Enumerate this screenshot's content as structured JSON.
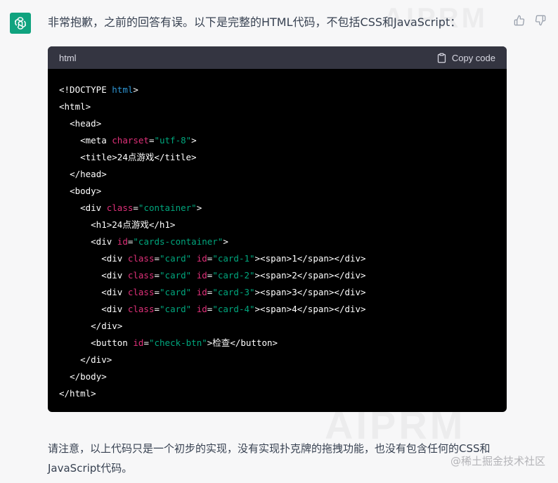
{
  "message": {
    "intro": "非常抱歉，之前的回答有误。以下是完整的HTML代码，不包括CSS和JavaScript：",
    "outro": "请注意，以上代码只是一个初步的实现，没有实现扑克牌的拖拽功能，也没有包含任何的CSS和JavaScript代码。"
  },
  "code_block": {
    "language": "html",
    "copy_label": "Copy code",
    "lines": [
      [
        {
          "t": "tag",
          "v": "<!DOCTYPE "
        },
        {
          "t": "kw",
          "v": "html"
        },
        {
          "t": "tag",
          "v": ">"
        }
      ],
      [
        {
          "t": "tag",
          "v": "<html>"
        }
      ],
      [
        {
          "t": "text",
          "v": "  "
        },
        {
          "t": "tag",
          "v": "<head>"
        }
      ],
      [
        {
          "t": "text",
          "v": "    "
        },
        {
          "t": "tag",
          "v": "<meta "
        },
        {
          "t": "attrname",
          "v": "charset"
        },
        {
          "t": "tag",
          "v": "="
        },
        {
          "t": "str",
          "v": "\"utf-8\""
        },
        {
          "t": "tag",
          "v": ">"
        }
      ],
      [
        {
          "t": "text",
          "v": "    "
        },
        {
          "t": "tag",
          "v": "<title>"
        },
        {
          "t": "text",
          "v": "24点游戏"
        },
        {
          "t": "tag",
          "v": "</title>"
        }
      ],
      [
        {
          "t": "text",
          "v": "  "
        },
        {
          "t": "tag",
          "v": "</head>"
        }
      ],
      [
        {
          "t": "text",
          "v": "  "
        },
        {
          "t": "tag",
          "v": "<body>"
        }
      ],
      [
        {
          "t": "text",
          "v": "    "
        },
        {
          "t": "tag",
          "v": "<div "
        },
        {
          "t": "attrname",
          "v": "class"
        },
        {
          "t": "tag",
          "v": "="
        },
        {
          "t": "str",
          "v": "\"container\""
        },
        {
          "t": "tag",
          "v": ">"
        }
      ],
      [
        {
          "t": "text",
          "v": "      "
        },
        {
          "t": "tag",
          "v": "<h1>"
        },
        {
          "t": "text",
          "v": "24点游戏"
        },
        {
          "t": "tag",
          "v": "</h1>"
        }
      ],
      [
        {
          "t": "text",
          "v": "      "
        },
        {
          "t": "tag",
          "v": "<div "
        },
        {
          "t": "attrname",
          "v": "id"
        },
        {
          "t": "tag",
          "v": "="
        },
        {
          "t": "str",
          "v": "\"cards-container\""
        },
        {
          "t": "tag",
          "v": ">"
        }
      ],
      [
        {
          "t": "text",
          "v": "        "
        },
        {
          "t": "tag",
          "v": "<div "
        },
        {
          "t": "attrname",
          "v": "class"
        },
        {
          "t": "tag",
          "v": "="
        },
        {
          "t": "str",
          "v": "\"card\""
        },
        {
          "t": "text",
          "v": " "
        },
        {
          "t": "attrname",
          "v": "id"
        },
        {
          "t": "tag",
          "v": "="
        },
        {
          "t": "str",
          "v": "\"card-1\""
        },
        {
          "t": "tag",
          "v": "><span>"
        },
        {
          "t": "text",
          "v": "1"
        },
        {
          "t": "tag",
          "v": "</span></div>"
        }
      ],
      [
        {
          "t": "text",
          "v": "        "
        },
        {
          "t": "tag",
          "v": "<div "
        },
        {
          "t": "attrname",
          "v": "class"
        },
        {
          "t": "tag",
          "v": "="
        },
        {
          "t": "str",
          "v": "\"card\""
        },
        {
          "t": "text",
          "v": " "
        },
        {
          "t": "attrname",
          "v": "id"
        },
        {
          "t": "tag",
          "v": "="
        },
        {
          "t": "str",
          "v": "\"card-2\""
        },
        {
          "t": "tag",
          "v": "><span>"
        },
        {
          "t": "text",
          "v": "2"
        },
        {
          "t": "tag",
          "v": "</span></div>"
        }
      ],
      [
        {
          "t": "text",
          "v": "        "
        },
        {
          "t": "tag",
          "v": "<div "
        },
        {
          "t": "attrname",
          "v": "class"
        },
        {
          "t": "tag",
          "v": "="
        },
        {
          "t": "str",
          "v": "\"card\""
        },
        {
          "t": "text",
          "v": " "
        },
        {
          "t": "attrname",
          "v": "id"
        },
        {
          "t": "tag",
          "v": "="
        },
        {
          "t": "str",
          "v": "\"card-3\""
        },
        {
          "t": "tag",
          "v": "><span>"
        },
        {
          "t": "text",
          "v": "3"
        },
        {
          "t": "tag",
          "v": "</span></div>"
        }
      ],
      [
        {
          "t": "text",
          "v": "        "
        },
        {
          "t": "tag",
          "v": "<div "
        },
        {
          "t": "attrname",
          "v": "class"
        },
        {
          "t": "tag",
          "v": "="
        },
        {
          "t": "str",
          "v": "\"card\""
        },
        {
          "t": "text",
          "v": " "
        },
        {
          "t": "attrname",
          "v": "id"
        },
        {
          "t": "tag",
          "v": "="
        },
        {
          "t": "str",
          "v": "\"card-4\""
        },
        {
          "t": "tag",
          "v": "><span>"
        },
        {
          "t": "text",
          "v": "4"
        },
        {
          "t": "tag",
          "v": "</span></div>"
        }
      ],
      [
        {
          "t": "text",
          "v": "      "
        },
        {
          "t": "tag",
          "v": "</div>"
        }
      ],
      [
        {
          "t": "text",
          "v": "      "
        },
        {
          "t": "tag",
          "v": "<button "
        },
        {
          "t": "attrname",
          "v": "id"
        },
        {
          "t": "tag",
          "v": "="
        },
        {
          "t": "str",
          "v": "\"check-btn\""
        },
        {
          "t": "tag",
          "v": ">"
        },
        {
          "t": "text",
          "v": "检查"
        },
        {
          "t": "tag",
          "v": "</button>"
        }
      ],
      [
        {
          "t": "text",
          "v": "    "
        },
        {
          "t": "tag",
          "v": "</div>"
        }
      ],
      [
        {
          "t": "text",
          "v": "  "
        },
        {
          "t": "tag",
          "v": "</body>"
        }
      ],
      [
        {
          "t": "tag",
          "v": "</html>"
        }
      ]
    ]
  },
  "watermarks": {
    "top": "AIPRM",
    "bottom": "AIPRM",
    "site": "@稀土掘金技术社区"
  },
  "icons": {
    "avatar": "openai-logo-icon",
    "thumbs_up": "thumbs-up-icon",
    "thumbs_down": "thumbs-down-icon",
    "copy": "clipboard-icon"
  },
  "colors": {
    "avatar_bg": "#10a37f",
    "code_bg": "#000000",
    "code_header_bg": "#343541",
    "string": "#00a67d",
    "attribute": "#df3079",
    "keyword": "#2e95d3"
  }
}
